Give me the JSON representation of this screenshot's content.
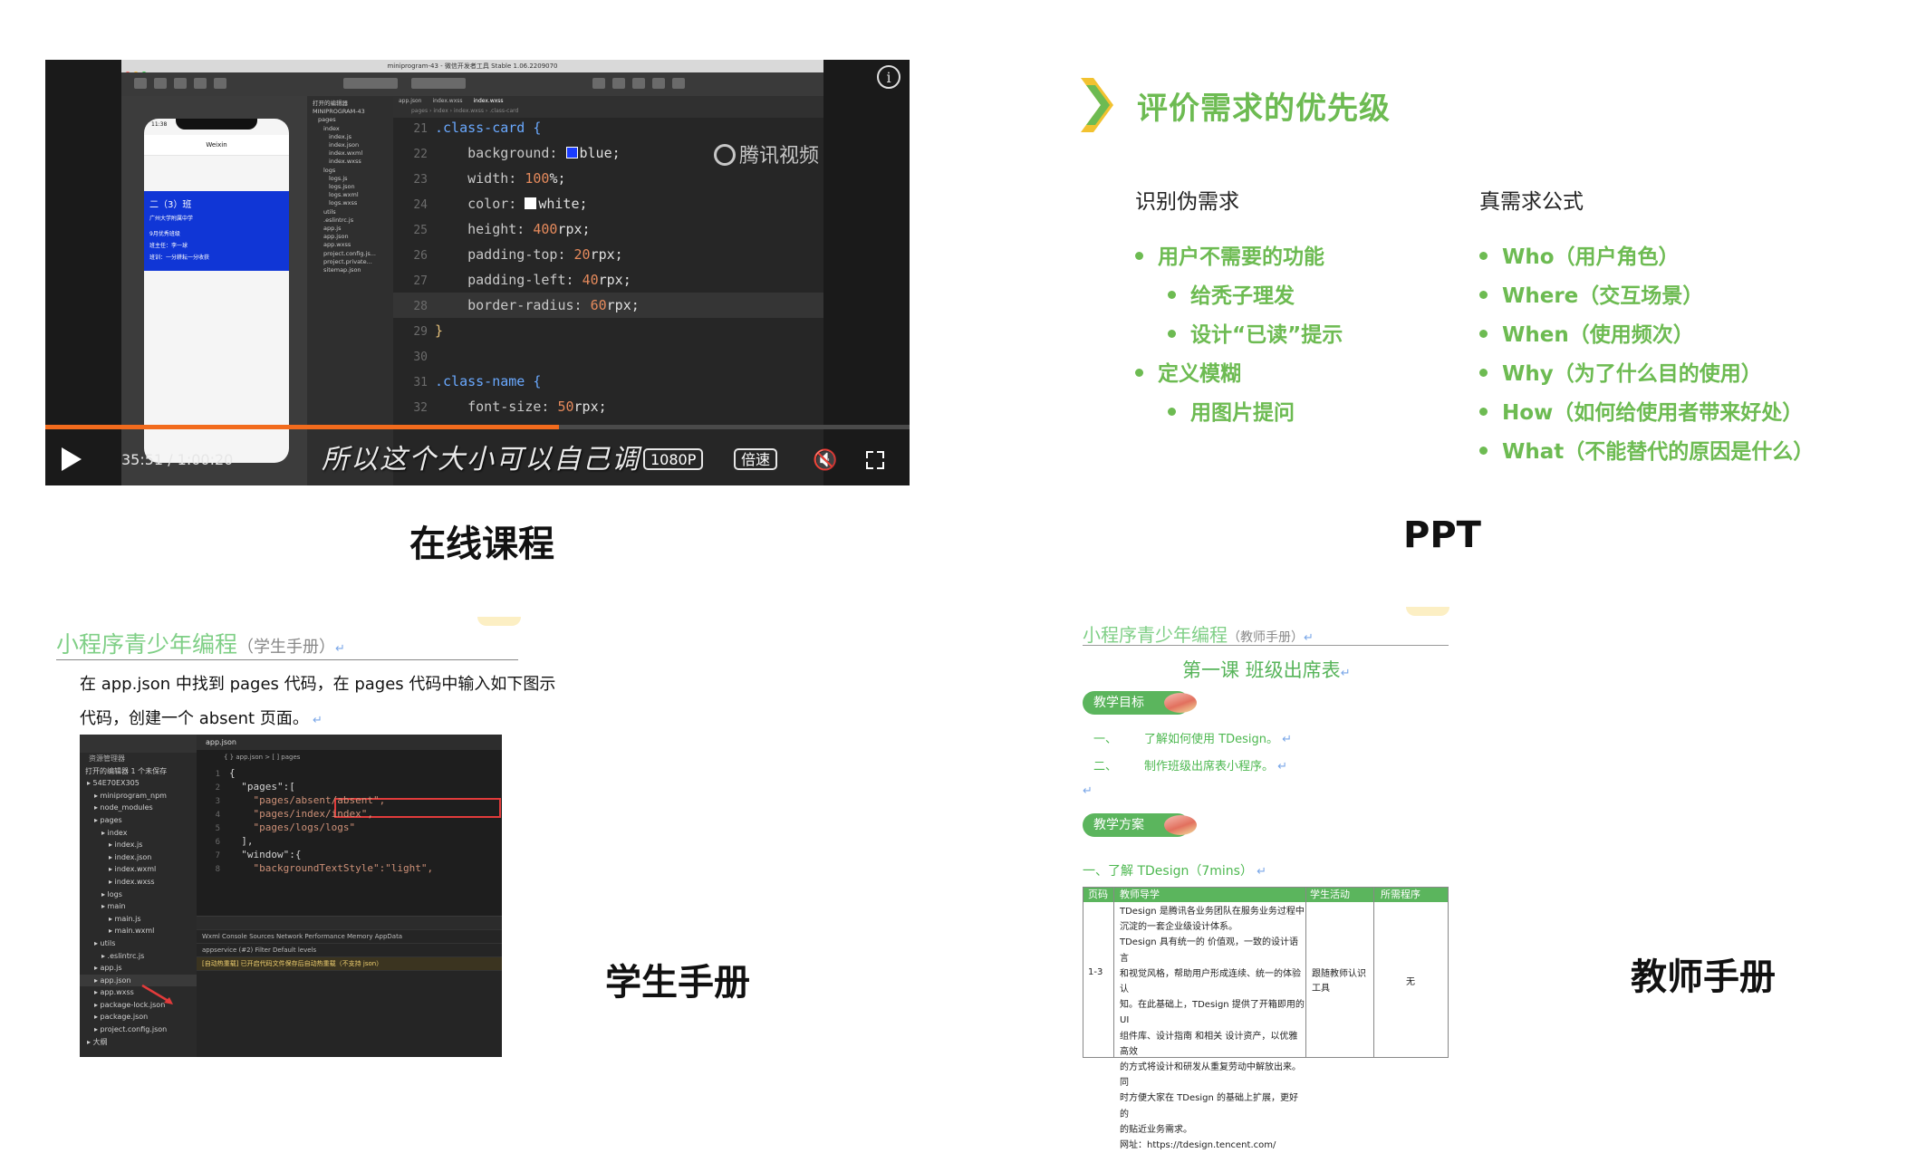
{
  "captions": {
    "online_course": "在线课程",
    "ppt": "PPT",
    "student_manual": "学生手册",
    "teacher_manual": "教师手册"
  },
  "video": {
    "window_title": "miniprogram-43 - 微信开发者工具 Stable 1.06.2209070",
    "watermark": "腾讯视频",
    "subtitle": "所以这个大小可以自己调",
    "time": "35:51 / 1:00:20",
    "quality": "1080P",
    "speed": "倍速",
    "progress": 0.594,
    "phone": {
      "time": "11:38",
      "nav_title": "Weixin",
      "class_name": "二（3）班",
      "school": "广州大学附属中学",
      "honor": "9月优秀班级",
      "teacher": "班主任：李一球",
      "motto": "班训：一分耕耘一分收获"
    },
    "file_tree": [
      "打开的编辑器",
      "MINIPROGRAM-43",
      "pages",
      "index",
      "index.js",
      "index.json",
      "index.wxml",
      "index.wxss",
      "logs",
      "logs.js",
      "logs.json",
      "logs.wxml",
      "logs.wxss",
      "utils",
      ".eslintrc.js",
      "app.js",
      "app.json",
      "app.wxss",
      "project.config.js...",
      "project.private...",
      "sitemap.json"
    ],
    "editor_tabs": [
      "app.json",
      "index.wxss",
      "index.wxss"
    ],
    "breadcrumb": "pages › index › index.wxss › .class-card",
    "code": [
      {
        "n": "21",
        "text": ".class-card {",
        "kind": "sel"
      },
      {
        "n": "22",
        "prop": "background",
        "value": "blue",
        "swatch": "#1a3cff"
      },
      {
        "n": "23",
        "prop": "width",
        "value": "100%"
      },
      {
        "n": "24",
        "prop": "color",
        "value": "white",
        "swatch": "#ffffff"
      },
      {
        "n": "25",
        "prop": "height",
        "value": "400rpx"
      },
      {
        "n": "26",
        "prop": "padding-top",
        "value": "20rpx"
      },
      {
        "n": "27",
        "prop": "padding-left",
        "value": "40rpx"
      },
      {
        "n": "28",
        "prop": "border-radius",
        "value": "60rpx"
      },
      {
        "n": "29",
        "text": "}",
        "kind": "brace"
      },
      {
        "n": "30",
        "text": "",
        "kind": "blank"
      },
      {
        "n": "31",
        "text": ".class-name {",
        "kind": "sel"
      },
      {
        "n": "32",
        "prop": "font-size",
        "value": "50rpx"
      }
    ]
  },
  "ppt": {
    "title": "评价需求的优先级",
    "left_heading": "识别伪需求",
    "left_items": [
      {
        "text": "用户不需要的功能",
        "level": 1
      },
      {
        "text": "给秃子理发",
        "level": 2
      },
      {
        "text": "设计“已读”提示",
        "level": 2
      },
      {
        "text": "定义模糊",
        "level": 1
      },
      {
        "text": "用图片提问",
        "level": 2
      }
    ],
    "right_heading": "真需求公式",
    "right_items": [
      "Who（用户角色）",
      "Where（交互场景）",
      "When（使用频次）",
      "Why（为了什么目的使用）",
      "How（如何给使用者带来好处）",
      "What（不能替代的原因是什么）"
    ],
    "accent": "#6dbb52"
  },
  "student": {
    "header": "小程序青少年编程",
    "header_sub": "（学生手册）",
    "para1": "在 app.json 中找到 pages 代码，在 pages 代码中输入如下图示",
    "para2": "代码，创建一个 absent 页面。",
    "explorer_title": "资源管理器",
    "open_editors": "打开的编辑器  1 个未保存",
    "tree": [
      "54E70EX305",
      "miniprogram_npm",
      "node_modules",
      "pages",
      "index",
      "index.js",
      "index.json",
      "index.wxml",
      "index.wxss",
      "logs",
      "main",
      "main.js",
      "main.wxml",
      "utils",
      ".eslintrc.js",
      "app.js",
      "app.json",
      "app.wxss",
      "package-lock.json",
      "package.json",
      "project.config.json",
      "大纲"
    ],
    "tab": "app.json",
    "crumb": "{ } app.json > [ ] pages",
    "code": [
      {
        "n": "1",
        "text": "{"
      },
      {
        "n": "2",
        "text": "  \"pages\":["
      },
      {
        "n": "3",
        "text": "    \"pages/absent/absent\","
      },
      {
        "n": "4",
        "text": "    \"pages/index/index\","
      },
      {
        "n": "5",
        "text": "    \"pages/logs/logs\""
      },
      {
        "n": "6",
        "text": "  ],"
      },
      {
        "n": "7",
        "text": "  \"window\":{"
      },
      {
        "n": "8",
        "text": "    \"backgroundTextStyle\":\"light\","
      }
    ],
    "console_tabs": "Wxml   Console   Sources   Network   Performance   Memory   AppData",
    "console_filter": "appservice (#2)      Filter      Default levels",
    "console_warn": "[自动热重载] 已开启代码文件保存后自动热重载（不支持 json）"
  },
  "teacher": {
    "header": "小程序青少年编程",
    "header_sub": "（教师手册）",
    "lesson": "第一课  班级出席表",
    "goal_tag": "教学目标",
    "goals": [
      {
        "k": "一、",
        "text": "了解如何使用 TDesign。"
      },
      {
        "k": "二、",
        "text": "制作班级出席表小程序。"
      }
    ],
    "plan_tag": "教学方案",
    "section": "一、了解 TDesign（7mins）",
    "table_headers": [
      "页码",
      "教师导学",
      "学生活动",
      "所需程序"
    ],
    "table_page": "1-3",
    "table_teacher": [
      "TDesign 是腾讯各业务团队在服务业务过程中",
      "沉淀的一套企业级设计体系。",
      "TDesign 具有统一的 价值观，一致的设计语言",
      "和视觉风格，帮助用户形成连续、统一的体验认",
      "知。在此基础上，TDesign 提供了开箱即用的 UI",
      "组件库、设计指南 和相关 设计资产，以优雅高效",
      "的方式将设计和研发从重复劳动中解放出来。同",
      "时方便大家在 TDesign 的基础上扩展，更好的",
      "的贴近业务需求。",
      "网址：https://tdesign.tencent.com/"
    ],
    "table_student": [
      "跟随教师认识",
      "工具"
    ],
    "table_program": "无"
  }
}
